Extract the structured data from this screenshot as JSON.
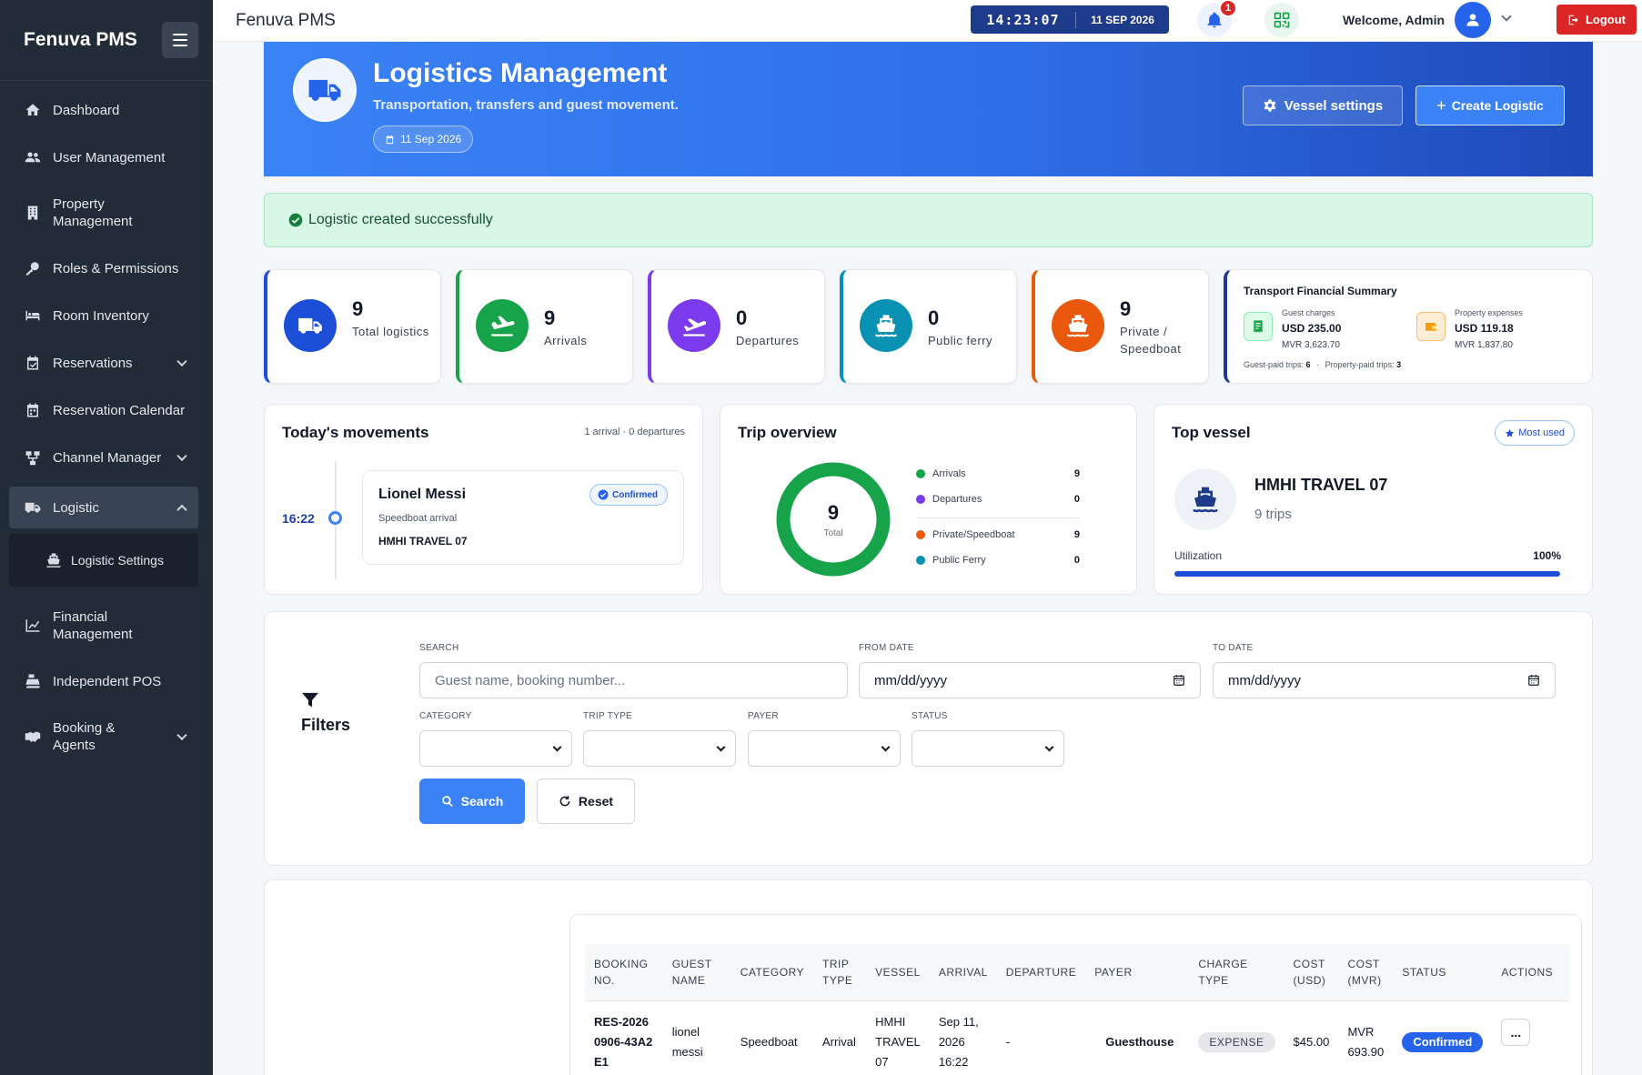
{
  "sidebar": {
    "brand": "Fenuva PMS",
    "items": [
      {
        "label": "Dashboard",
        "icon": "home-icon"
      },
      {
        "label": "User Management",
        "icon": "users-icon"
      },
      {
        "label": "Property Management",
        "icon": "building-icon"
      },
      {
        "label": "Roles & Permissions",
        "icon": "key-icon"
      },
      {
        "label": "Room Inventory",
        "icon": "bed-icon"
      },
      {
        "label": "Reservations",
        "icon": "calendar-check-icon"
      },
      {
        "label": "Reservation Calendar",
        "icon": "calendar-icon"
      },
      {
        "label": "Channel Manager",
        "icon": "network-icon"
      },
      {
        "label": "Logistic",
        "icon": "truck-icon"
      },
      {
        "label": "Financial Management",
        "icon": "chart-line-icon"
      },
      {
        "label": "Independent POS",
        "icon": "cash-register-icon"
      },
      {
        "label": "Booking & Agents",
        "icon": "handshake-icon"
      }
    ],
    "subitem": {
      "label": "Logistic Settings",
      "icon": "ship-icon"
    }
  },
  "topbar": {
    "title": "Fenuva PMS",
    "time": "14:23:07",
    "date": "11 SEP 2026",
    "notifications": "1",
    "welcome": "Welcome, Admin",
    "logout": "Logout"
  },
  "hero": {
    "title": "Logistics Management",
    "subtitle": "Transportation, transfers and guest movement.",
    "date": "11 Sep 2026",
    "vessel_settings": "Vessel settings",
    "create": "Create Logistic"
  },
  "alert": {
    "message": "Logistic created successfully"
  },
  "stats": [
    {
      "value": "9",
      "label": "Total logistics",
      "color": "#1d4ed8"
    },
    {
      "value": "9",
      "label": "Arrivals",
      "color": "#16a34a"
    },
    {
      "value": "0",
      "label": "Departures",
      "color": "#7c3aed"
    },
    {
      "value": "0",
      "label": "Public ferry",
      "color": "#0891b2"
    },
    {
      "value": "9",
      "label": "Private / Speedboat",
      "color": "#ea580c"
    }
  ],
  "financial": {
    "title": "Transport Financial Summary",
    "guest_caption": "Guest charges",
    "guest_usd": "USD 235.00",
    "guest_mvr": "MVR 3,623.70",
    "property_caption": "Property expenses",
    "property_usd": "USD 119.18",
    "property_mvr": "MVR 1,837.80",
    "guest_trips_label": "Guest-paid trips:",
    "guest_trips": "6",
    "property_trips_label": "Property-paid trips:",
    "property_trips": "3",
    "separator": "·"
  },
  "movements": {
    "title": "Today's movements",
    "meta": "1 arrival · 0 departures",
    "time": "16:22",
    "guest": "Lionel Messi",
    "type": "Speedboat arrival",
    "vessel": "HMHI TRAVEL 07",
    "status": "Confirmed"
  },
  "overview": {
    "title": "Trip overview",
    "total": "9",
    "total_label": "Total",
    "legend": [
      {
        "label": "Arrivals",
        "value": "9",
        "color": "#16a34a"
      },
      {
        "label": "Departures",
        "value": "0",
        "color": "#7c3aed"
      },
      {
        "label": "Private/Speedboat",
        "value": "9",
        "color": "#ea580c"
      },
      {
        "label": "Public Ferry",
        "value": "0",
        "color": "#0891b2"
      }
    ],
    "donut_fraction": 1.0
  },
  "top_vessel": {
    "title": "Top vessel",
    "badge": "Most used",
    "name": "HMHI TRAVEL 07",
    "trips": "9 trips",
    "util_label": "Utilization",
    "util_value": "100%",
    "util_fraction": 1.0
  },
  "filters": {
    "title": "Filters",
    "search_label": "SEARCH",
    "search_placeholder": "Guest name, booking number...",
    "from_label": "FROM DATE",
    "from_value": "mm/dd/yyyy",
    "to_label": "TO DATE",
    "to_value": "mm/dd/yyyy",
    "category_label": "CATEGORY",
    "trip_type_label": "TRIP TYPE",
    "payer_label": "PAYER",
    "status_label": "STATUS",
    "search_button": "Search",
    "reset_button": "Reset"
  },
  "table": {
    "headers": [
      "BOOKING NO.",
      "GUEST NAME",
      "CATEGORY",
      "TRIP TYPE",
      "VESSEL",
      "ARRIVAL",
      "DEPARTURE",
      "PAYER",
      "CHARGE TYPE",
      "COST (USD)",
      "COST (MVR)",
      "STATUS",
      "ACTIONS"
    ],
    "rows": [
      {
        "booking": "RES-20260906-43A2E1",
        "guest": "lionel messi",
        "category": "Speedboat",
        "trip_type": "Arrival",
        "vessel": "HMHI TRAVEL 07",
        "arrival": "Sep 11, 2026 16:22",
        "departure": "-",
        "payer": "Guesthouse",
        "charge_type": "EXPENSE",
        "cost_usd": "$45.00",
        "cost_mvr": "MVR 693.90",
        "status": "Confirmed",
        "actions": "..."
      }
    ]
  }
}
